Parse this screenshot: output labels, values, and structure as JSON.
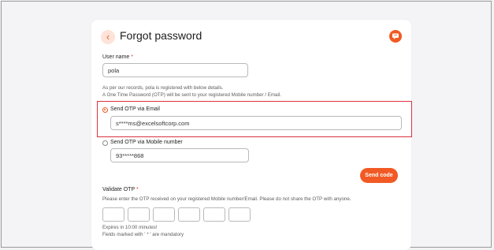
{
  "header": {
    "title": "Forgot password",
    "back_icon": "chevron-left-icon",
    "help_icon": "chat-icon"
  },
  "username": {
    "label": "User name",
    "required_mark": "*",
    "value": "pola"
  },
  "info": {
    "line1": "As per our records, pola is registered with below details.",
    "line2": "A One Time Password (OTP) will be sent to your registered Mobile number / Email."
  },
  "otp_options": {
    "email": {
      "label": "Send OTP via Email",
      "value": "s****ms@excelsoftcorp.com",
      "selected": true
    },
    "mobile": {
      "label": "Send OTP via Mobile number",
      "value": "93*****868",
      "selected": false
    }
  },
  "send_button": {
    "label": "Send code"
  },
  "validate": {
    "label": "Validate OTP",
    "required_mark": "*",
    "instructions": "Please enter the OTP received on your registered Mobile number/Email. Please do not share the OTP with anyone.",
    "boxes": [
      "",
      "",
      "",
      "",
      "",
      ""
    ],
    "expires": "Expires in 10:00 minutes!",
    "mandatory_note": "Fields marked with ' * ' are mandatory"
  },
  "colors": {
    "accent": "#f15a24",
    "highlight_border": "#d9333f"
  }
}
